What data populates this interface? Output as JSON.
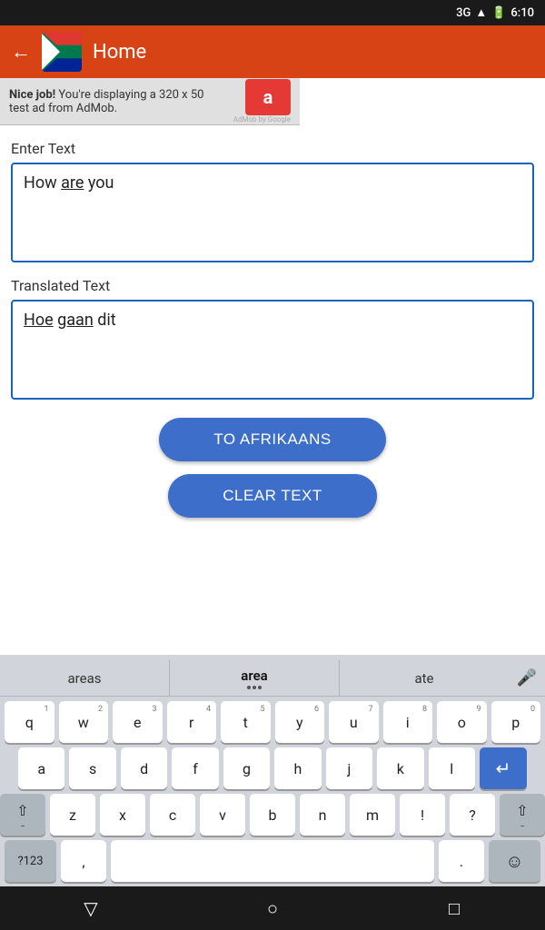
{
  "statusBar": {
    "signal": "3G",
    "time": "6:10"
  },
  "topBar": {
    "title": "Home",
    "backLabel": "←"
  },
  "ad": {
    "text1": "Nice job!",
    "text2": " You're displaying a 320 x 50",
    "text3": " test ad from AdMob.",
    "logoLetter": "a",
    "poweredBy": "AdMob by Google"
  },
  "enterTextLabel": "Enter Text",
  "inputText": "How are you",
  "translatedTextLabel": "Translated Text",
  "translatedText": "Hoe gaan dit",
  "buttons": {
    "translate": "TO AFRIKAANS",
    "clear": "CLEAR TEXT"
  },
  "keyboard": {
    "suggestions": [
      "areas",
      "area",
      "ate"
    ],
    "rows": [
      [
        "q",
        "w",
        "e",
        "r",
        "t",
        "y",
        "u",
        "i",
        "o",
        "p"
      ],
      [
        "a",
        "s",
        "d",
        "f",
        "g",
        "h",
        "j",
        "k",
        "l"
      ],
      [
        "z",
        "x",
        "c",
        "v",
        "b",
        "n",
        "m"
      ]
    ],
    "numbers": [
      "1",
      "2",
      "3",
      "4",
      "5",
      "6",
      "7",
      "8",
      "9",
      "0"
    ],
    "symLabel": "?123",
    "spaceLabel": "",
    "emojiLabel": "☺"
  },
  "navbar": {
    "back": "▽",
    "home": "○",
    "recent": "□"
  }
}
